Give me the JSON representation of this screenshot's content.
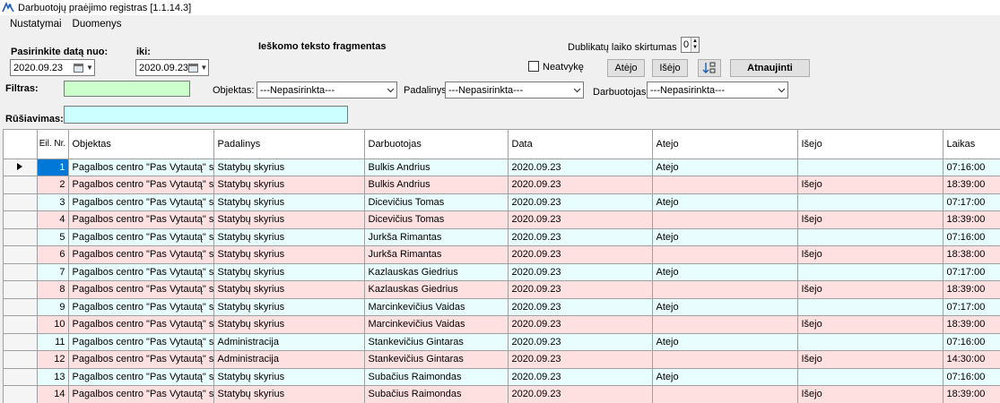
{
  "window": {
    "title": "Darbuotojų praėjimo registras [1.1.14.3]",
    "icon": "app-arrow-icon"
  },
  "menu": [
    "Nustatymai",
    "Duomenys"
  ],
  "filters": {
    "date_from_label": "Pasirinkite datą nuo:",
    "date_to_label": "iki:",
    "date_from": "2020.09.23",
    "date_to": "2020.09.23",
    "search_fragment_label": "Ieškomo teksto fragmentas",
    "duplicates_label": "Dublikatų laiko skirtumas",
    "duplicates_value": "0",
    "absent_label": "Neatvykę",
    "absent_checked": false,
    "btn_atejo": "Atėjo",
    "btn_isejo": "Išėjo",
    "btn_refresh": "Atnaujinti",
    "filter_label": "Filtras:",
    "filter_value": "",
    "object_label": "Objektas:",
    "object_value": "---Nepasirinkta---",
    "division_label": "Padalinys:",
    "division_value": "---Nepasirinkta---",
    "employee_label": "Darbuotojas:",
    "employee_value": "---Nepasirinkta---",
    "sort_label": "Rūšiavimas:",
    "sort_value": ""
  },
  "grid": {
    "columns": [
      "Eil. Nr.",
      "Objektas",
      "Padalinys",
      "Darbuotojas",
      "Data",
      "Atejo",
      "Išejo",
      "Laikas"
    ],
    "rows": [
      [
        "1",
        "Pagalbos centro \"Pas Vytautą\" st...",
        "Statybų skyrius",
        "Bulkis Andrius",
        "2020.09.23",
        "Atejo",
        "",
        "07:16:00"
      ],
      [
        "2",
        "Pagalbos centro \"Pas Vytautą\" st...",
        "Statybų skyrius",
        "Bulkis Andrius",
        "2020.09.23",
        "",
        "Išejo",
        "18:39:00"
      ],
      [
        "3",
        "Pagalbos centro \"Pas Vytautą\" st...",
        "Statybų skyrius",
        "Dicevičius Tomas",
        "2020.09.23",
        "Atejo",
        "",
        "07:17:00"
      ],
      [
        "4",
        "Pagalbos centro \"Pas Vytautą\" st...",
        "Statybų skyrius",
        "Dicevičius Tomas",
        "2020.09.23",
        "",
        "Išejo",
        "18:39:00"
      ],
      [
        "5",
        "Pagalbos centro \"Pas Vytautą\" st...",
        "Statybų skyrius",
        "Jurkša Rimantas",
        "2020.09.23",
        "Atejo",
        "",
        "07:16:00"
      ],
      [
        "6",
        "Pagalbos centro \"Pas Vytautą\" st...",
        "Statybų skyrius",
        "Jurkša Rimantas",
        "2020.09.23",
        "",
        "Išejo",
        "18:38:00"
      ],
      [
        "7",
        "Pagalbos centro \"Pas Vytautą\" st...",
        "Statybų skyrius",
        "Kazlauskas Giedrius",
        "2020.09.23",
        "Atejo",
        "",
        "07:17:00"
      ],
      [
        "8",
        "Pagalbos centro \"Pas Vytautą\" st...",
        "Statybų skyrius",
        "Kazlauskas Giedrius",
        "2020.09.23",
        "",
        "Išejo",
        "18:39:00"
      ],
      [
        "9",
        "Pagalbos centro \"Pas Vytautą\" st...",
        "Statybų skyrius",
        "Marcinkevičius Vaidas",
        "2020.09.23",
        "Atejo",
        "",
        "07:17:00"
      ],
      [
        "10",
        "Pagalbos centro \"Pas Vytautą\" st...",
        "Statybų skyrius",
        "Marcinkevičius Vaidas",
        "2020.09.23",
        "",
        "Išejo",
        "18:39:00"
      ],
      [
        "11",
        "Pagalbos centro \"Pas Vytautą\" st...",
        "Administracija",
        "Stankevičius Gintaras",
        "2020.09.23",
        "Atejo",
        "",
        "07:16:00"
      ],
      [
        "12",
        "Pagalbos centro \"Pas Vytautą\" st...",
        "Administracija",
        "Stankevičius Gintaras",
        "2020.09.23",
        "",
        "Išejo",
        "14:30:00"
      ],
      [
        "13",
        "Pagalbos centro \"Pas Vytautą\" st...",
        "Statybų skyrius",
        "Subačius Raimondas",
        "2020.09.23",
        "Atejo",
        "",
        "07:16:00"
      ],
      [
        "14",
        "Pagalbos centro \"Pas Vytautą\" st...",
        "Statybų skyrius",
        "Subačius Raimondas",
        "2020.09.23",
        "",
        "Išejo",
        "18:39:00"
      ]
    ],
    "current_row": 0
  },
  "colors": {
    "row_in": "#e8fdfd",
    "row_out": "#ffe0e0",
    "selected_cell": "#0078d7",
    "filter_input": "#ccffcc",
    "sort_input": "#ccffff"
  }
}
